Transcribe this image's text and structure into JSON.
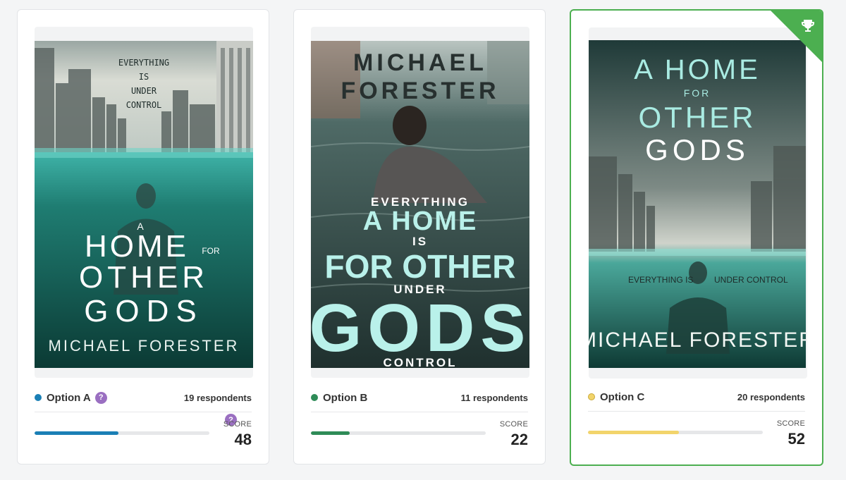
{
  "options": [
    {
      "label": "Option A",
      "respondents": "19 respondents",
      "score_label": "SCORE",
      "score": "48",
      "dot_color": "#1a7fb5",
      "bar_color": "#1a7fb5",
      "progress": 0.48,
      "cover": {
        "tagline": [
          "EVERYTHING",
          "IS",
          "UNDER",
          "CONTROL"
        ],
        "title_small_a": "A",
        "title_home": "HOME",
        "title_for": "FOR",
        "title_other": "OTHER",
        "title_gods": "GODS",
        "author": "MICHAEL FORESTER"
      }
    },
    {
      "label": "Option B",
      "respondents": "11 respondents",
      "score_label": "SCORE",
      "score": "22",
      "dot_color": "#2e8b57",
      "bar_color": "#2e8b57",
      "progress": 0.22,
      "cover": {
        "author_first": "MICHAEL",
        "author_last": "FORESTER",
        "line1": "EVERYTHING",
        "line2": "A HOME",
        "line3": "IS",
        "line4": "FOR OTHER",
        "line5": "UNDER",
        "line6": "GODS",
        "line7": "CONTROL"
      }
    },
    {
      "label": "Option C",
      "respondents": "20 respondents",
      "score_label": "SCORE",
      "score": "52",
      "dot_color": "#f2d46b",
      "bar_color": "#f2d46b",
      "progress": 0.52,
      "winner": true,
      "cover": {
        "title_a_home": "A HOME",
        "title_for": "FOR",
        "title_other": "OTHER",
        "title_gods": "GODS",
        "tagline_left": "EVERYTHING IS",
        "tagline_right": "UNDER CONTROL",
        "author": "MICHAEL FORESTER"
      }
    }
  ],
  "help_glyph": "?",
  "icons": {
    "help": "question-circle-icon",
    "trophy": "trophy-icon"
  },
  "colors": {
    "winner_border": "#4caf50",
    "help_badge": "#9a6fc1"
  }
}
